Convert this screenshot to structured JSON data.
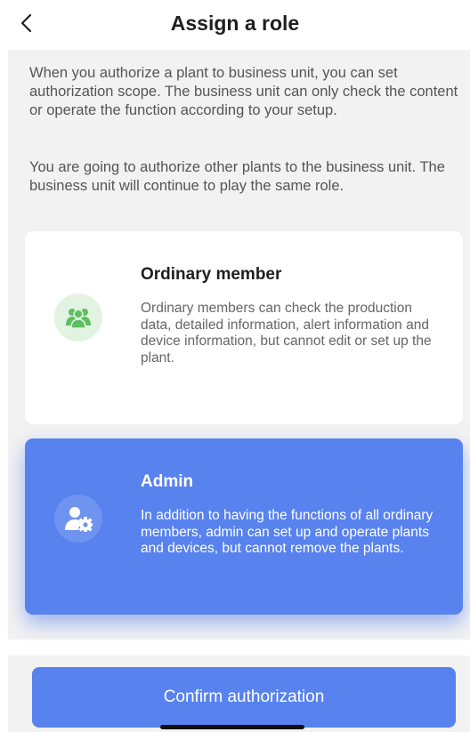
{
  "header": {
    "title": "Assign a role",
    "back_icon": "chevron-left-icon"
  },
  "intro": {
    "paragraph1": "When you authorize a plant to business unit, you can set authorization scope. The business unit can only check the content or operate the function according to your setup.",
    "paragraph2": "You are going to authorize other plants to the business unit. The business unit will continue to play the same role."
  },
  "roles": [
    {
      "title": "Ordinary member",
      "description": "Ordinary members can check the production data, detailed information, alert information and device information, but cannot edit or set up the plant.",
      "icon": "group-icon",
      "selected": false,
      "icon_color": "#5cc060"
    },
    {
      "title": "Admin",
      "description": "In addition to having the functions of all ordinary members, admin can set up and operate plants and devices, but cannot remove the plants.",
      "icon": "admin-gear-icon",
      "selected": true,
      "icon_color": "#ffffff"
    }
  ],
  "footer": {
    "confirm_label": "Confirm authorization"
  },
  "colors": {
    "accent": "#5882ee",
    "background": "#f2f2f2",
    "member_icon_bg": "#e3f3e2"
  }
}
